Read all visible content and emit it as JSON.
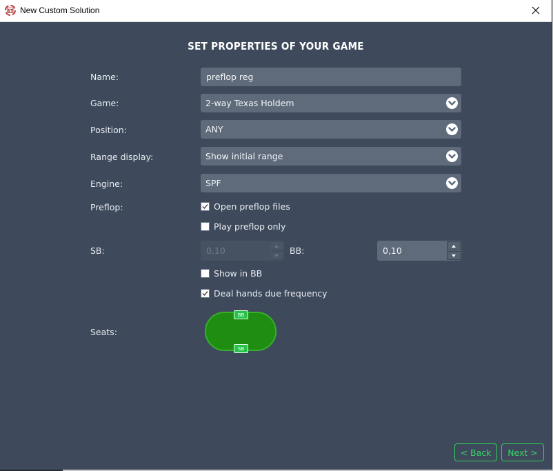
{
  "window": {
    "title": "New Custom Solution",
    "app_icon": "st-logo-icon",
    "close_icon": "close-icon"
  },
  "heading": "SET PROPERTIES OF YOUR GAME",
  "form": {
    "name": {
      "label": "Name:",
      "value": "preflop reg"
    },
    "game": {
      "label": "Game:",
      "value": "2-way Texas Holdem"
    },
    "position": {
      "label": "Position:",
      "value": "ANY"
    },
    "range_display": {
      "label": "Range display:",
      "value": "Show initial range"
    },
    "engine": {
      "label": "Engine:",
      "value": "SPF"
    },
    "preflop": {
      "label": "Preflop:",
      "open_preflop_files": {
        "label": "Open preflop files",
        "checked": true
      },
      "play_preflop_only": {
        "label": "Play preflop only",
        "checked": false
      }
    },
    "sb": {
      "label": "SB:",
      "value": "0,10",
      "enabled": false
    },
    "bb": {
      "label": "BB:",
      "value": "0,10",
      "enabled": true
    },
    "show_in_bb": {
      "label": "Show in BB",
      "checked": false
    },
    "deal_hands_due_frequency": {
      "label": "Deal hands due frequency",
      "checked": true
    },
    "seats": {
      "label": "Seats:",
      "seat_labels": [
        "BB",
        "SB"
      ]
    }
  },
  "buttons": {
    "back": "< Back",
    "next": "Next >"
  },
  "colors": {
    "background": "#3e4a5c",
    "field": "#5f6b7b",
    "accent_green": "#2ecc5a",
    "table_green": "#1f8c12"
  }
}
